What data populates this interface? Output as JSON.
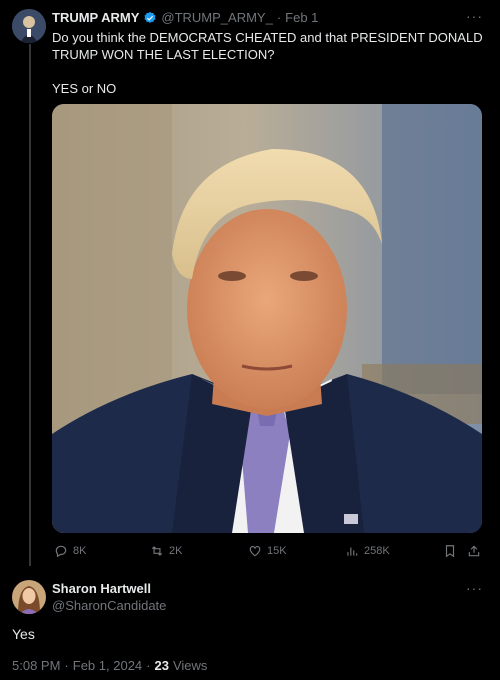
{
  "tweet": {
    "author_name": "TRUMP ARMY",
    "handle": "@TRUMP_ARMY_",
    "separator": "·",
    "date": "Feb 1",
    "text_line1": "Do you think the DEMOCRATS CHEATED and that PRESIDENT DONALD",
    "text_line2": "TRUMP WON THE LAST ELECTION?",
    "text_line3": "YES or NO",
    "more_label": "···",
    "stats": {
      "replies": "8K",
      "reposts": "2K",
      "likes": "15K",
      "views": "258K"
    },
    "icons": [
      "verified-icon",
      "reply-icon",
      "repost-icon",
      "like-icon",
      "views-icon",
      "bookmark-icon",
      "share-icon"
    ]
  },
  "reply": {
    "author_name": "Sharon Hartwell",
    "handle": "@SharonCandidate",
    "text": "Yes",
    "more_label": "···",
    "time": "5:08 PM",
    "separator": "·",
    "date": "Feb 1, 2024",
    "separator2": "·",
    "views_count": "23",
    "views_label": "Views"
  },
  "colors": {
    "background": "#000000",
    "text": "#e7e9ea",
    "muted": "#71767b",
    "verified": "#1d9bf0"
  }
}
